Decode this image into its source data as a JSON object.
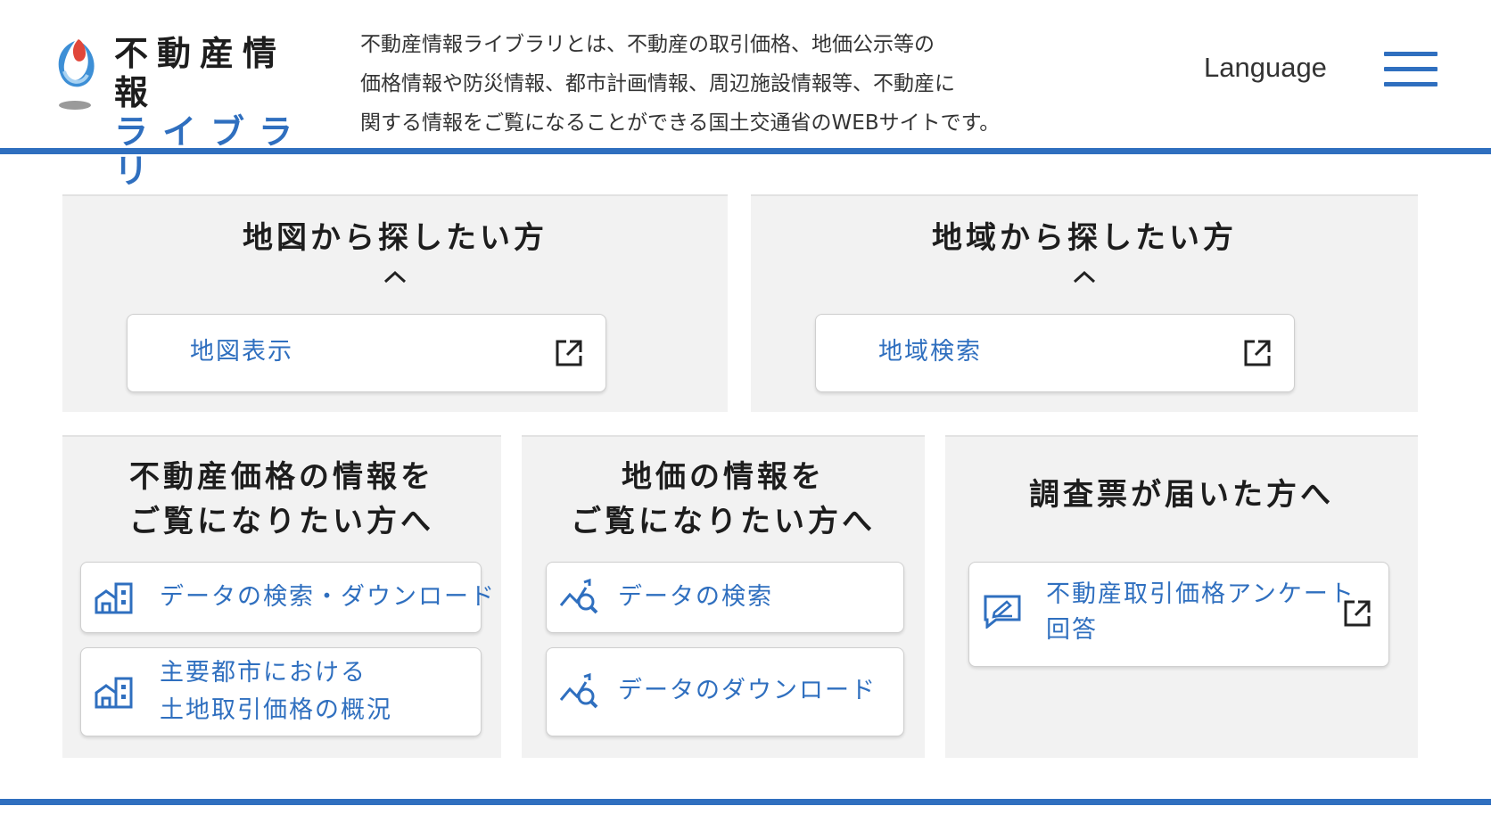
{
  "header": {
    "logo_line1": "不動産情報",
    "logo_line2": "ライブラリ",
    "description": [
      "不動産情報ライブラリとは、不動産の取引価格、地価公示等の",
      "価格情報や防災情報、都市計画情報、周辺施設情報等、不動産に",
      "関する情報をご覧になることができる国土交通省のWEBサイトです。"
    ],
    "language_label": "Language",
    "menu_icon": "hamburger-menu-icon"
  },
  "panels": {
    "map": {
      "title": "地図から探したい方",
      "button_label": "地図表示",
      "icon": "external-link-icon"
    },
    "region": {
      "title": "地域から探したい方",
      "button_label": "地域検索",
      "icon": "external-link-icon"
    },
    "price": {
      "title_line1": "不動産価格の情報を",
      "title_line2": "ご覧になりたい方へ",
      "buttons": [
        {
          "label": "データの検索・ダウンロード",
          "icon": "building-icon"
        },
        {
          "label_line1": "主要都市における",
          "label_line2": "土地取引価格の概況",
          "icon": "building-icon"
        }
      ]
    },
    "land": {
      "title_line1": "地価の情報を",
      "title_line2": "ご覧になりたい方へ",
      "buttons": [
        {
          "label": "データの検索",
          "icon": "chart-search-icon"
        },
        {
          "label": "データのダウンロード",
          "icon": "chart-search-icon"
        }
      ]
    },
    "survey": {
      "title": "調査票が届いた方へ",
      "button_label_line1": "不動産取引価格アンケート",
      "button_label_line2": "回答",
      "icons": [
        "survey-edit-icon",
        "external-link-icon"
      ]
    }
  },
  "colors": {
    "accent": "#2f6fbf",
    "panel_bg": "#f2f2f2",
    "logo_red": "#e0463a",
    "logo_blue": "#3d8fd6"
  }
}
